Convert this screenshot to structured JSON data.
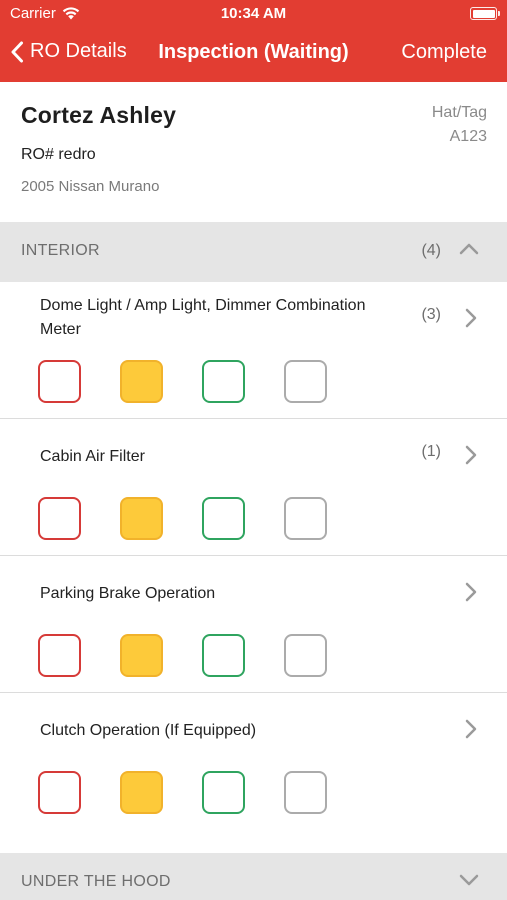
{
  "status_bar": {
    "carrier": "Carrier",
    "time": "10:34 AM"
  },
  "nav": {
    "back_label": "RO Details",
    "title": "Inspection (Waiting)",
    "complete_label": "Complete"
  },
  "customer": {
    "name": "Cortez Ashley",
    "ro": "RO# redro",
    "vehicle": "2005 Nissan Murano",
    "hat_label": "Hat/Tag",
    "hat_value": "A123"
  },
  "sections": [
    {
      "title": "INTERIOR",
      "count": "(4)",
      "expanded": true,
      "items": [
        {
          "label": "Dome Light / Amp Light, Dimmer Combination Meter",
          "count": "(3)"
        },
        {
          "label": "Cabin Air Filter",
          "count": "(1)"
        },
        {
          "label": "Parking Brake Operation",
          "count": ""
        },
        {
          "label": "Clutch Operation (If Equipped)",
          "count": ""
        }
      ]
    },
    {
      "title": "UNDER THE HOOD",
      "count": "",
      "expanded": false
    }
  ],
  "status_options": [
    "red",
    "yellow",
    "green",
    "gray"
  ],
  "colors": {
    "header": "#e23d32",
    "red": "#d63a38",
    "yellow": "#fdca3a",
    "green": "#2fa45f",
    "gray": "#ababab",
    "section_bg": "#e5e5e5"
  }
}
